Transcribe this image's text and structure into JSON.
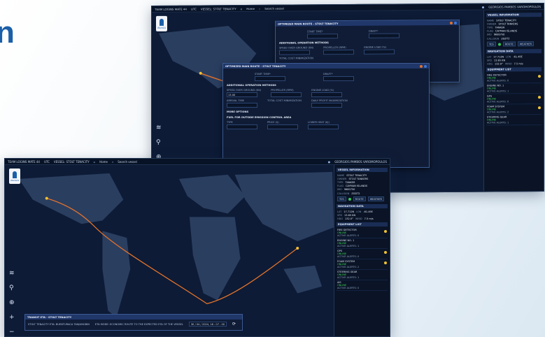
{
  "brand": {
    "fragment": "n"
  },
  "topbar": {
    "app": "TEAM LOGINS MATE 44",
    "utc": "UTC",
    "vessel": "VESSEL: STOLT TENACITY",
    "home": "Home",
    "search_placeholder": "Search vessel",
    "user": "GEORGIOS PAMBOS VAROMOPOULOS"
  },
  "logo": {
    "label": "Wärtsilä"
  },
  "vessel_info": {
    "header": "VESSEL INFORMATION",
    "rows": [
      {
        "k": "NAME",
        "v": "STOLT TENACITY"
      },
      {
        "k": "OWNER",
        "v": "STOLT TANKERS"
      },
      {
        "k": "TYPE",
        "v": "TANKER"
      },
      {
        "k": "FLAG",
        "v": "CAYMAN ISLANDS"
      },
      {
        "k": "IMO",
        "v": "9680750"
      },
      {
        "k": "CALLSIGN",
        "v": "ZGDT2"
      }
    ]
  },
  "toggles": {
    "a": "TCS",
    "b": "ROUTE",
    "c": "WEATHER"
  },
  "nav_data": {
    "header": "NAVIGATION DATA",
    "rows": [
      {
        "k": "LAT",
        "v": "17.712N"
      },
      {
        "k": "LON",
        "v": "-61.49E"
      },
      {
        "k": "SPD",
        "v": "13.65 KN"
      },
      {
        "k": "HDG",
        "v": "132.0°"
      },
      {
        "k": "WIND",
        "v": "7.5 m/s"
      }
    ]
  },
  "equipment": {
    "header": "EQUIPMENT LIST",
    "items": [
      {
        "name": "FIRE DETECTOR",
        "state": "ONLINE",
        "alerts": "ACTIVE ALERTS: 0"
      },
      {
        "name": "ENGINE NO. 1",
        "state": "ONLINE",
        "alerts": "ACTIVE ALERTS: 1"
      },
      {
        "name": "GPS",
        "state": "ONLINE",
        "alerts": "ACTIVE ALERTS: 0"
      },
      {
        "name": "FOAM SYSTEM",
        "state": "ONLINE",
        "alerts": "ACTIVE ALERTS: 2"
      },
      {
        "name": "STEERING GEAR",
        "state": "ONLINE",
        "alerts": "ACTIVE ALERTS: 1"
      },
      {
        "name": "AIS",
        "state": "ONLINE",
        "alerts": "ACTIVE ALERTS: 0"
      }
    ]
  },
  "dialog_back": {
    "title": "OPTIMIZED MAIN ROUTE - STOLT TENACITY",
    "start_label": "START TIME*",
    "start_value": "",
    "draft_label": "DRAFT*",
    "section": "ADDITIONAL OPERATION METHODS",
    "f1": "SPEED OVER GROUND (KN)",
    "f2": "PROPELLER (RPM)",
    "f3": "ENGINE LOAD (%)",
    "f4": "TOTAL COST MINIMIZATION"
  },
  "dialog_front": {
    "title": "OPTIMIZED MAIN ROUTE - STOLT TENACITY",
    "start_label": "START TIME*",
    "draft_label": "DRAFT*",
    "section": "ADDITIONAL OPERATION METHODS",
    "f1": "SPEED OVER GROUND (KN)",
    "f2": "PROPELLER (RPM)",
    "f3": "ENGINE LOAD (%)",
    "sog_value": "13.00",
    "arrival_label": "ARRIVAL TIME",
    "f5": "TOTAL COST MINIMIZATION",
    "f6": "DAILY PROFIT MAXIMIZATION",
    "more": "MORE OPTIONS",
    "eca": "FUEL FOR OUTSIDE EMISSION CONTROL AREA",
    "type": "TYPE",
    "price": "PRICE ($)",
    "lower": "LOWER HEAT (KJ)"
  },
  "route_bar": {
    "title": "TRANSIT ETA - STOLT TENACITY",
    "text_a": "STOLT TENACITY ETA: BUENTURACA TANJUNGBIN",
    "text_b": "ETA MODE: ECONOMIC ROUTE TO THE EXPECTED ETA OF THE VESSEL",
    "date": "30 / 04 / 2024, 18 : 07 : 00"
  },
  "colors": {
    "route": "#e3722a",
    "accent": "#1b5fa8",
    "online": "#41d35b",
    "warn": "#f1c232"
  }
}
